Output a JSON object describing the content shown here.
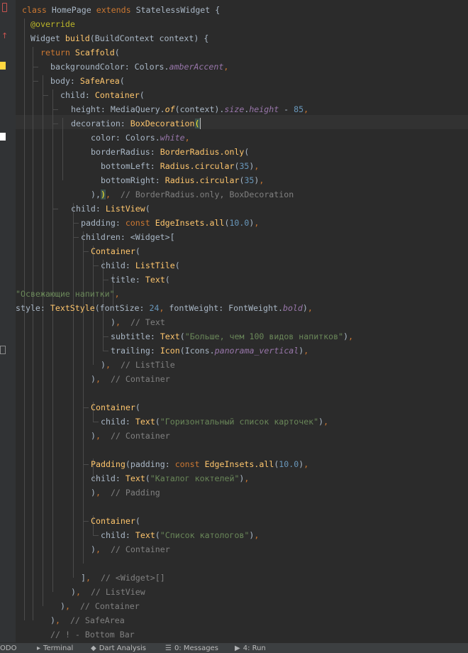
{
  "editor": {
    "lines": [
      [
        [
          "k",
          "class "
        ],
        [
          "d",
          "HomePage "
        ],
        [
          "k",
          "extends "
        ],
        [
          "d",
          "StatelessWidget {"
        ]
      ],
      [
        [
          "a",
          "@override"
        ]
      ],
      [
        [
          "d",
          "Widget "
        ],
        [
          "f",
          "build"
        ],
        [
          "d",
          "(BuildContext context) {"
        ]
      ],
      [
        [
          "k",
          "return "
        ],
        [
          "f",
          "Scaffold"
        ],
        [
          "d",
          "("
        ]
      ],
      [
        [
          "d",
          "backgroundColor: Colors."
        ],
        [
          "p",
          "amberAccent"
        ],
        [
          "k",
          ","
        ]
      ],
      [
        [
          "d",
          "body: "
        ],
        [
          "f",
          "SafeArea"
        ],
        [
          "d",
          "("
        ]
      ],
      [
        [
          "d",
          "child: "
        ],
        [
          "f",
          "Container"
        ],
        [
          "d",
          "("
        ]
      ],
      [
        [
          "d",
          "height: MediaQuery."
        ],
        [
          "fi",
          "of"
        ],
        [
          "d",
          "(context)."
        ],
        [
          "p",
          "size"
        ],
        [
          "d",
          "."
        ],
        [
          "p",
          "height"
        ],
        [
          "d",
          " - "
        ],
        [
          "n",
          "85"
        ],
        [
          "k",
          ","
        ]
      ],
      [
        [
          "d",
          "decoration: "
        ],
        [
          "f",
          "BoxDecoration"
        ],
        [
          "b",
          "("
        ]
      ],
      [
        [
          "d",
          "color: Colors."
        ],
        [
          "p",
          "white"
        ],
        [
          "k",
          ","
        ]
      ],
      [
        [
          "d",
          "borderRadius: "
        ],
        [
          "f",
          "BorderRadius.only"
        ],
        [
          "d",
          "("
        ]
      ],
      [
        [
          "d",
          "bottomLeft: "
        ],
        [
          "f",
          "Radius.circular"
        ],
        [
          "d",
          "("
        ],
        [
          "n",
          "35"
        ],
        [
          "d",
          ")"
        ],
        [
          "k",
          ","
        ]
      ],
      [
        [
          "d",
          "bottomRight: "
        ],
        [
          "f",
          "Radius.circular"
        ],
        [
          "d",
          "("
        ],
        [
          "n",
          "35"
        ],
        [
          "d",
          ")"
        ],
        [
          "k",
          ","
        ]
      ],
      [
        [
          "d",
          "),"
        ],
        [
          "b",
          ")"
        ],
        [
          "k",
          ",  "
        ],
        [
          "c",
          "// BorderRadius.only, BoxDecoration"
        ]
      ],
      [
        [
          "d",
          "child: "
        ],
        [
          "f",
          "ListView"
        ],
        [
          "d",
          "("
        ]
      ],
      [
        [
          "d",
          "padding: "
        ],
        [
          "k",
          "const "
        ],
        [
          "f",
          "EdgeInsets.all"
        ],
        [
          "d",
          "("
        ],
        [
          "n",
          "10.0"
        ],
        [
          "d",
          ")"
        ],
        [
          "k",
          ","
        ]
      ],
      [
        [
          "d",
          "children: <Widget>["
        ]
      ],
      [
        [
          "f",
          "Container"
        ],
        [
          "d",
          "("
        ]
      ],
      [
        [
          "d",
          "child: "
        ],
        [
          "f",
          "ListTile"
        ],
        [
          "d",
          "("
        ]
      ],
      [
        [
          "d",
          "title: "
        ],
        [
          "f",
          "Text"
        ],
        [
          "d",
          "("
        ]
      ],
      [
        [
          "s",
          "\"Освежающие напитки\""
        ],
        [
          "k",
          ","
        ]
      ],
      [
        [
          "d",
          "style: "
        ],
        [
          "f",
          "TextStyle"
        ],
        [
          "d",
          "(fontSize: "
        ],
        [
          "n",
          "24"
        ],
        [
          "k",
          ", "
        ],
        [
          "d",
          "fontWeight: FontWeight."
        ],
        [
          "p",
          "bold"
        ],
        [
          "d",
          ")"
        ],
        [
          "k",
          ","
        ]
      ],
      [
        [
          "d",
          ")"
        ],
        [
          "k",
          ",  "
        ],
        [
          "c",
          "// Text"
        ]
      ],
      [
        [
          "d",
          "subtitle: "
        ],
        [
          "f",
          "Text"
        ],
        [
          "d",
          "("
        ],
        [
          "s",
          "\"Больше, чем 100 видов напитков\""
        ],
        [
          "d",
          ")"
        ],
        [
          "k",
          ","
        ]
      ],
      [
        [
          "d",
          "trailing: "
        ],
        [
          "f",
          "Icon"
        ],
        [
          "d",
          "(Icons."
        ],
        [
          "p",
          "panorama_vertical"
        ],
        [
          "d",
          ")"
        ],
        [
          "k",
          ","
        ]
      ],
      [
        [
          "d",
          ")"
        ],
        [
          "k",
          ",  "
        ],
        [
          "c",
          "// ListTile"
        ]
      ],
      [
        [
          "d",
          ")"
        ],
        [
          "k",
          ",  "
        ],
        [
          "c",
          "// Container"
        ]
      ],
      [],
      [
        [
          "f",
          "Container"
        ],
        [
          "d",
          "("
        ]
      ],
      [
        [
          "d",
          "child: "
        ],
        [
          "f",
          "Text"
        ],
        [
          "d",
          "("
        ],
        [
          "s",
          "\"Горизонтальный список карточек\""
        ],
        [
          "d",
          ")"
        ],
        [
          "k",
          ","
        ]
      ],
      [
        [
          "d",
          ")"
        ],
        [
          "k",
          ",  "
        ],
        [
          "c",
          "// Container"
        ]
      ],
      [],
      [
        [
          "f",
          "Padding"
        ],
        [
          "d",
          "(padding: "
        ],
        [
          "k",
          "const "
        ],
        [
          "f",
          "EdgeInsets.all"
        ],
        [
          "d",
          "("
        ],
        [
          "n",
          "10.0"
        ],
        [
          "d",
          ")"
        ],
        [
          "k",
          ","
        ]
      ],
      [
        [
          "d",
          "child: "
        ],
        [
          "f",
          "Text"
        ],
        [
          "d",
          "("
        ],
        [
          "s",
          "\"Каталог коктелей\""
        ],
        [
          "d",
          ")"
        ],
        [
          "k",
          ","
        ]
      ],
      [
        [
          "d",
          ")"
        ],
        [
          "k",
          ",  "
        ],
        [
          "c",
          "// Padding"
        ]
      ],
      [],
      [
        [
          "f",
          "Container"
        ],
        [
          "d",
          "("
        ]
      ],
      [
        [
          "d",
          "child: "
        ],
        [
          "f",
          "Text"
        ],
        [
          "d",
          "("
        ],
        [
          "s",
          "\"Список катологов\""
        ],
        [
          "d",
          ")"
        ],
        [
          "k",
          ","
        ]
      ],
      [
        [
          "d",
          ")"
        ],
        [
          "k",
          ",  "
        ],
        [
          "c",
          "// Container"
        ]
      ],
      [],
      [
        [
          "d",
          "]"
        ],
        [
          "k",
          ",  "
        ],
        [
          "c",
          "// <Widget>[]"
        ]
      ],
      [
        [
          "d",
          ")"
        ],
        [
          "k",
          ",  "
        ],
        [
          "c",
          "// ListView"
        ]
      ],
      [
        [
          "d",
          ")"
        ],
        [
          "k",
          ",  "
        ],
        [
          "c",
          "// Container"
        ]
      ],
      [
        [
          "d",
          ")"
        ],
        [
          "k",
          ",  "
        ],
        [
          "c",
          "// SafeArea"
        ]
      ],
      [
        [
          "c",
          "// ! - Bottom Bar"
        ]
      ]
    ]
  },
  "statusbar": {
    "items": [
      {
        "icon": "todo-icon",
        "glyph": "",
        "label": "ODO"
      },
      {
        "icon": "terminal-icon",
        "glyph": "▸",
        "label": "Terminal"
      },
      {
        "icon": "dart-analysis-icon",
        "glyph": "◆",
        "label": "Dart Analysis"
      },
      {
        "icon": "messages-icon",
        "glyph": "☰",
        "label": "0: Messages"
      },
      {
        "icon": "run-icon",
        "glyph": "▶",
        "label": "4: Run"
      }
    ]
  },
  "colors": {
    "background": "#2b2b2b",
    "gutter": "#313335",
    "keyword": "#cc7832",
    "function": "#ffc66d",
    "string": "#6a8759",
    "number": "#6897bb",
    "comment": "#808080",
    "annotation": "#bbb529",
    "property": "#9876aa"
  }
}
